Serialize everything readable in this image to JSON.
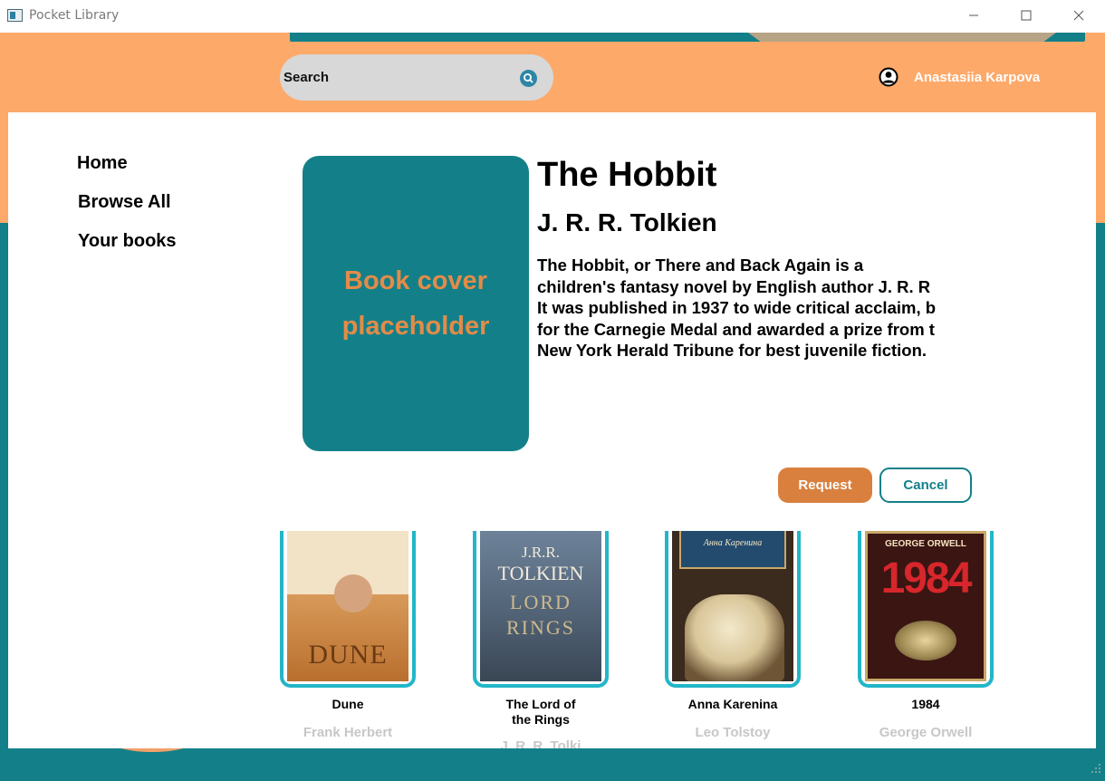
{
  "window": {
    "title": "Pocket Library",
    "minimize_glyph": "—",
    "maximize_glyph": "☐",
    "close_glyph": "✕"
  },
  "header": {
    "search_placeholder": "Search",
    "user_name": "Anastasiia Karpova"
  },
  "sidebar": {
    "items": [
      {
        "label": "Home"
      },
      {
        "label": "Browse All"
      },
      {
        "label": "Your books"
      }
    ]
  },
  "book": {
    "cover_placeholder_line1": "Book cover",
    "cover_placeholder_line2": "placeholder",
    "title": "The Hobbit",
    "author": "J. R. R. Tolkien",
    "description_lines": [
      "The Hobbit, or There and Back Again is a",
      "children's fantasy novel by English author J. R. R",
      "It was published in 1937 to wide critical acclaim, b",
      "for the Carnegie Medal and awarded a prize from t",
      "New York Herald Tribune for best juvenile fiction."
    ]
  },
  "actions": {
    "request_label": "Request",
    "cancel_label": "Cancel"
  },
  "recommendations": [
    {
      "title": "Dune",
      "author": "Frank Herbert",
      "cover_text": "DUNE"
    },
    {
      "title_line1": "The Lord of",
      "title_line2": "the Rings",
      "author": "J. R. R. Tolki",
      "cover_line1": "J.R.R.",
      "cover_line2": "TOLKIEN",
      "cover_line3": "LORD",
      "cover_line4": "RINGS"
    },
    {
      "title": "Anna Karenina",
      "author": "Leo Tolstoy",
      "cover_text": "Анна Каренина"
    },
    {
      "title": "1984",
      "author": "George Orwell",
      "cover_author": "GEORGE ORWELL",
      "cover_year": "1984"
    }
  ],
  "colors": {
    "teal": "#138089",
    "orange_header": "#fda96a",
    "request_button": "#d9803f",
    "card_border": "#22b6c8",
    "author_gray": "#c7c7c7"
  }
}
